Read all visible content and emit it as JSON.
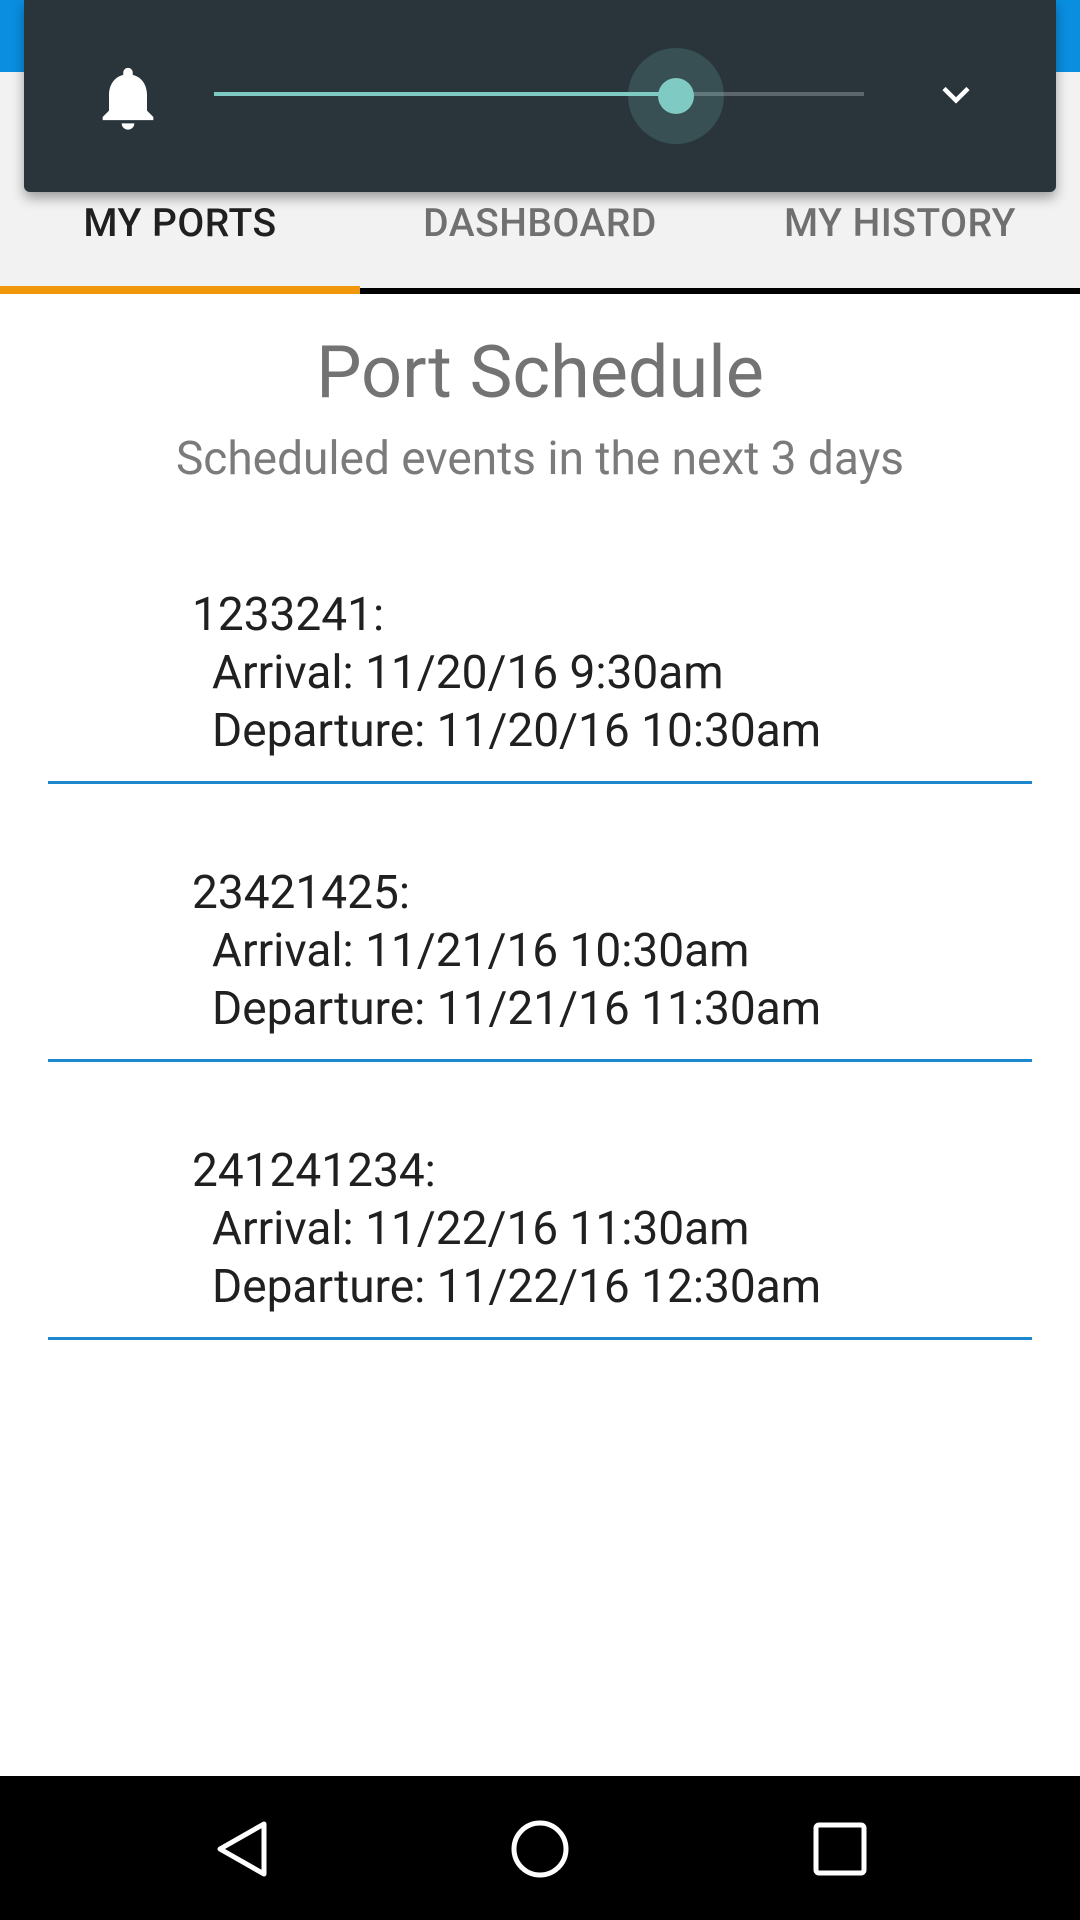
{
  "tabs": [
    {
      "label": "MY PORTS",
      "active": true
    },
    {
      "label": "DASHBOARD",
      "active": false
    },
    {
      "label": "MY HISTORY",
      "active": false
    }
  ],
  "page": {
    "title": "Port Schedule",
    "subtitle": "Scheduled events in the next 3 days"
  },
  "events": [
    {
      "id": "1233241:",
      "arrival": "Arrival: 11/20/16 9:30am",
      "departure": "Departure: 11/20/16 10:30am"
    },
    {
      "id": "23421425:",
      "arrival": "Arrival: 11/21/16 10:30am",
      "departure": "Departure: 11/21/16 11:30am"
    },
    {
      "id": "241241234:",
      "arrival": "Arrival: 11/22/16 11:30am",
      "departure": "Departure: 11/22/16 12:30am"
    }
  ],
  "volume_panel": {
    "icon": "bell-icon",
    "level": 0.71,
    "expand_icon": "chevron-down-icon"
  },
  "navbar": {
    "icons": [
      "back-icon",
      "home-icon",
      "recents-icon"
    ]
  },
  "colors": {
    "accent_indicator": "#f0980a",
    "divider": "#1e88cc",
    "slider": "#7fcbc4",
    "top_bar": "#0a8ee0"
  }
}
